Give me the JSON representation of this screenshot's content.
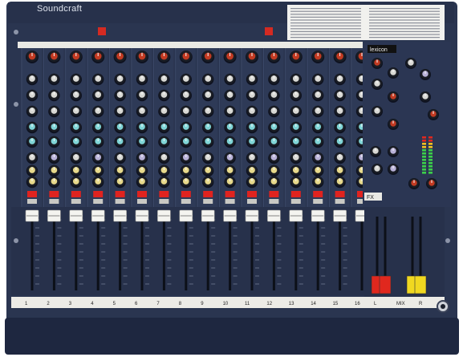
{
  "brand": {
    "name": "Soundcraft"
  },
  "mixer": {
    "channel_count": 16,
    "channel_numbers": [
      "1",
      "2",
      "3",
      "4",
      "5",
      "6",
      "7",
      "8",
      "9",
      "10",
      "11",
      "12",
      "13",
      "14",
      "15",
      "16"
    ],
    "fx_unit_label": "lexicon",
    "fx_panel_label": "FX",
    "master_labels": [
      "L",
      "MIX",
      "R"
    ]
  },
  "colors": {
    "chassis": "#2a3550",
    "chassis_dark": "#1b2338",
    "panel_light": "#f2f2ee",
    "strip": "#2e3a57",
    "knob_red": "#c23a22",
    "knob_cyan": "#7fd4d6",
    "knob_yellow": "#e6d88a",
    "knob_lilac": "#b9b2d8",
    "mute_red": "#e0231f",
    "fader_cap": "#f4f4f0",
    "master_red_cap": "#e0281e",
    "master_yellow_cap": "#f0d820"
  }
}
